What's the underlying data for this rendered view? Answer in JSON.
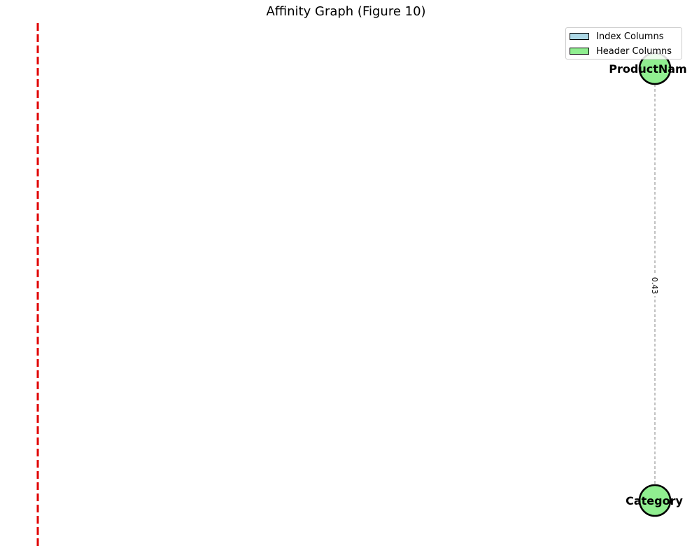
{
  "title": "Affinity Graph (Figure 10)",
  "legend": {
    "items": [
      {
        "label": "Index Columns",
        "color": "#add8e6"
      },
      {
        "label": "Header Columns",
        "color": "#90ee90"
      }
    ]
  },
  "graph": {
    "nodes": [
      {
        "id": "productname",
        "label": "ProductNam",
        "group": "header",
        "color": "#90ee90"
      },
      {
        "id": "category",
        "label": "Category",
        "group": "header",
        "color": "#90ee90"
      }
    ],
    "edges": [
      {
        "source": "productname",
        "target": "category",
        "weight": "0.43",
        "style": "dashed",
        "color": "#999999"
      }
    ],
    "divider": {
      "color": "#e00000",
      "style": "dashed"
    }
  }
}
